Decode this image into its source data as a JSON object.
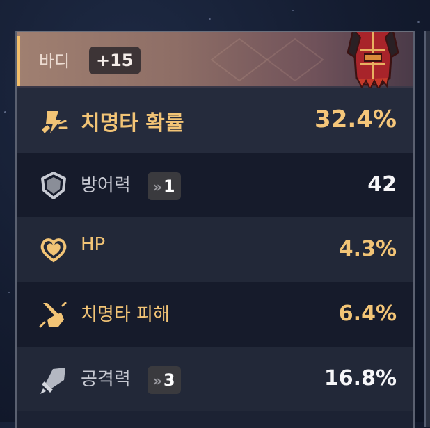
{
  "item": {
    "name": "바디",
    "level": "+15"
  },
  "stats": [
    {
      "label": "치명타 확률",
      "value": "32.4%",
      "icon": "crit-rate-icon",
      "main": true
    },
    {
      "label": "방어력",
      "value": "42",
      "icon": "defense-shield-icon",
      "reroll_count": "1"
    },
    {
      "label": "HP",
      "value": "4.3%",
      "icon": "hp-heart-icon"
    },
    {
      "label": "치명타 피해",
      "value": "6.4%",
      "icon": "crit-damage-icon"
    },
    {
      "label": "공격력",
      "value": "16.8%",
      "icon": "attack-sword-icon",
      "reroll_count": "3"
    }
  ],
  "colors": {
    "gold": "#f2c476",
    "header_accent": "#f4bf6a",
    "row_dark": "#161b2b",
    "row_light": "#222838"
  }
}
